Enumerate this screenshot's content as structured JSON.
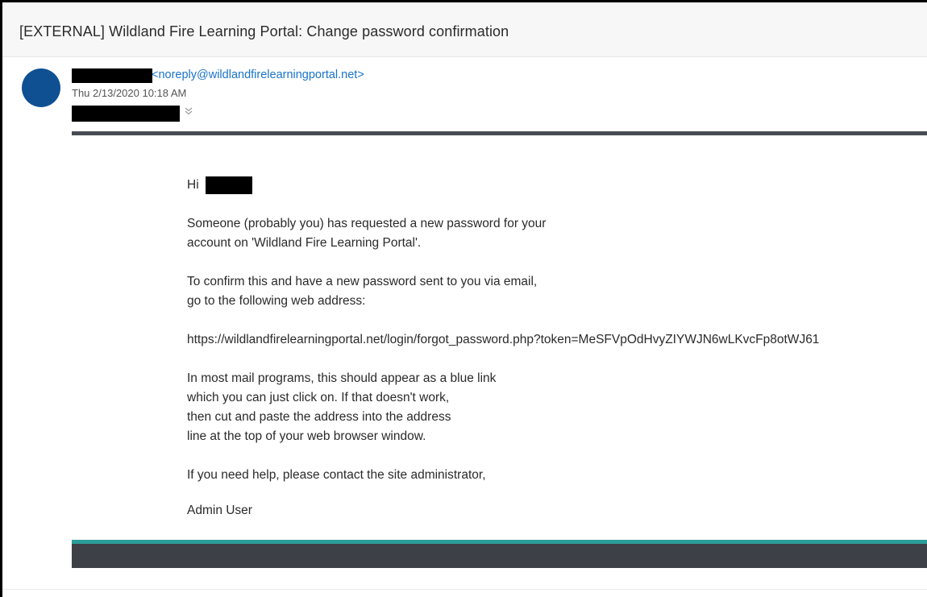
{
  "email": {
    "subject": "[EXTERNAL] Wildland Fire Learning Portal: Change password confirmation",
    "sender_email": "<noreply@wildlandfirelearningportal.net>",
    "sent_date": "Thu 2/13/2020 10:18 AM",
    "avatar_color": "#0f5093",
    "link_color": "#1a73c8"
  },
  "body": {
    "greeting": "Hi",
    "p1_line1": "Someone (probably you) has requested a new password for your",
    "p1_line2": "account on 'Wildland Fire Learning Portal'.",
    "p2_line1": "To confirm this and have a new password sent to you via email,",
    "p2_line2": "go to the following web address:",
    "reset_url": "https://wildlandfirelearningportal.net/login/forgot_password.php?token=MeSFVpOdHvyZIYWJN6wLKvcFp8otWJ61",
    "p3_line1": "In most mail programs, this should appear as a blue link",
    "p3_line2": "which you can just click on. If that doesn't work,",
    "p3_line3": "then cut and paste the address into the address",
    "p3_line4": "line at the top of your web browser window.",
    "p4": "If you need help, please contact the site administrator,",
    "signature": "Admin User"
  },
  "theme": {
    "header_rule": "#474b52",
    "footer_accent": "#2a9d99",
    "footer_dark": "#3d4046"
  }
}
